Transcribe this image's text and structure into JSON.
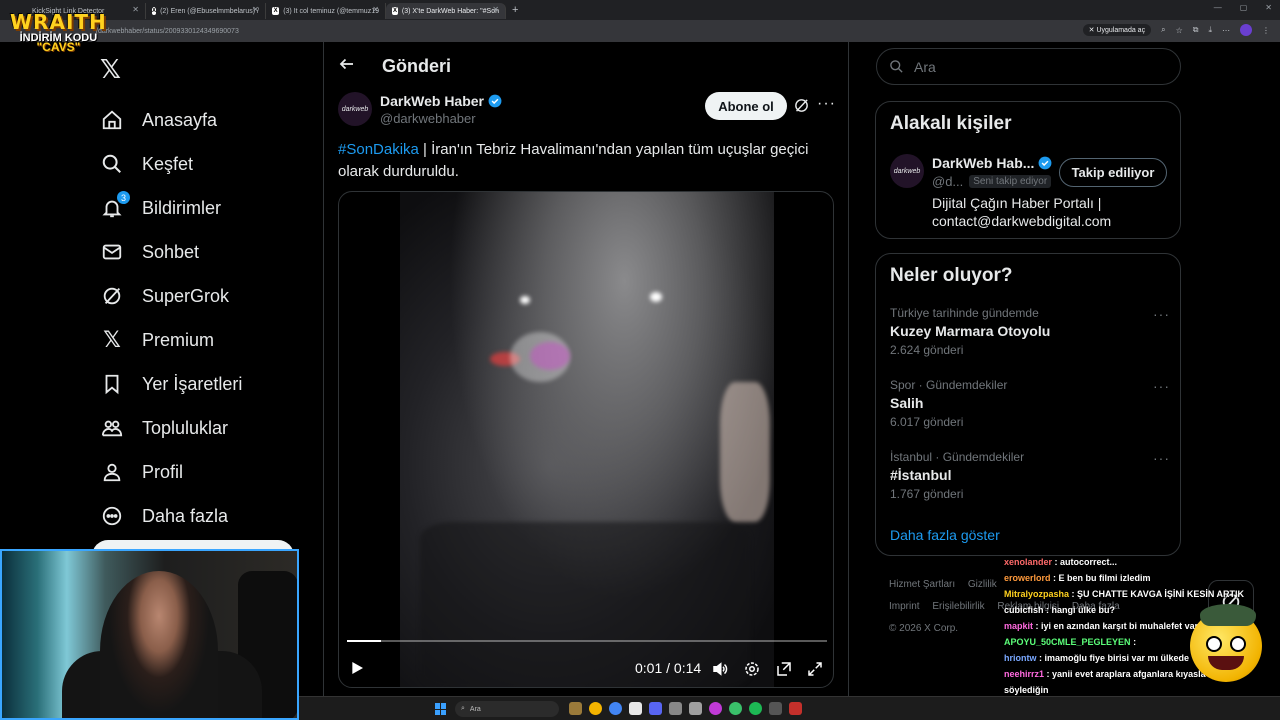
{
  "browser": {
    "tabs": [
      {
        "label": "KickSight Link Detector",
        "active": false
      },
      {
        "label": "(2) Eren (@Ebuselmmbelarus) /",
        "active": false
      },
      {
        "label": "(3) It col teminuz (@temmuz19",
        "active": false
      },
      {
        "label": "(3) X'te DarkWeb Haber: \"#Son",
        "active": true
      }
    ],
    "url": "/darkwebhaber/status/2009330124349690073",
    "open_in_app": "Uygulamada aç"
  },
  "overlay": {
    "brand": "WRAITH",
    "line2": "İNDİRİM KODU",
    "code": "\"CAVS\""
  },
  "nav": {
    "items": [
      {
        "label": "Anasayfa",
        "icon": "home-icon"
      },
      {
        "label": "Keşfet",
        "icon": "search-icon"
      },
      {
        "label": "Bildirimler",
        "icon": "bell-icon",
        "badge": "3"
      },
      {
        "label": "Sohbet",
        "icon": "mail-icon"
      },
      {
        "label": "SuperGrok",
        "icon": "grok-icon"
      },
      {
        "label": "Premium",
        "icon": "x-icon"
      },
      {
        "label": "Yer İşaretleri",
        "icon": "bookmark-icon"
      },
      {
        "label": "Topluluklar",
        "icon": "communities-icon"
      },
      {
        "label": "Profil",
        "icon": "profile-icon"
      },
      {
        "label": "Daha fazla",
        "icon": "more-circle-icon"
      }
    ]
  },
  "main": {
    "title": "Gönderi",
    "post": {
      "author": "DarkWeb Haber",
      "handle": "@darkwebhaber",
      "avatar_text": "darkweb",
      "subscribe_label": "Abone ol",
      "hashtag": "#SonDakika",
      "text": " | İran'ın Tebriz Havalimanı'ndan yapılan tüm uçuşlar geçici olarak durduruldu.",
      "video": {
        "current_time": "0:01",
        "separator": " / ",
        "duration": "0:14",
        "progress": 0.07
      }
    }
  },
  "right": {
    "search_placeholder": "Ara",
    "related": {
      "title": "Alakalı kişiler",
      "name": "DarkWeb Hab...",
      "handle": "@d...",
      "follows_you": "Seni takip ediyor",
      "follow_label": "Takip ediliyor",
      "bio": "Dijital Çağın Haber Portalı | contact@darkwebdigital.com"
    },
    "trends": {
      "title": "Neler oluyor?",
      "items": [
        {
          "meta": "Türkiye tarihinde gündemde",
          "name": "Kuzey Marmara Otoyolu",
          "count": "2.624 gönderi"
        },
        {
          "meta": "Spor · Gündemdekiler",
          "name": "Salih",
          "count": "6.017 gönderi"
        },
        {
          "meta": "İstanbul · Gündemdekiler",
          "name": "#İstanbul",
          "count": "1.767 gönderi"
        }
      ],
      "show_more": "Daha fazla göster"
    },
    "footer": {
      "links": [
        "Hizmet Şartları",
        "Gizlilik",
        "Imprint",
        "Erişilebilirlik",
        "Reklam bilgisi",
        "Daha fazla"
      ],
      "copyright": "© 2026 X Corp."
    }
  },
  "chat": [
    {
      "user": "xenolander",
      "color": "#ff6a6a",
      "msg": ": autocorrect..."
    },
    {
      "user": "erowerlord",
      "color": "#ff9a3c",
      "msg": ": E ben bu filmi izledim"
    },
    {
      "user": "Mitralyozpasha",
      "color": "#ffd21f",
      "msg": ": ŞU CHATTE KAVGA İŞİNİ KESİN ARTIK"
    },
    {
      "user": "cubicfish",
      "color": "#ffffff",
      "msg": ": hangi ülke bu?"
    },
    {
      "user": "mapkit",
      "color": "#ff6adf",
      "msg": ": iyi en azından karşıt bi muhalefet var"
    },
    {
      "user": "APOYU_50CMLE_PEGLEYEN",
      "color": "#5cff7a",
      "msg": ":"
    },
    {
      "user": "hriontw",
      "color": "#7aa8ff",
      "msg": ": imamoğlu fiye birisi var mı ülkede"
    },
    {
      "user": "neehirrz1",
      "color": "#ff6adf",
      "msg": ": yanii evet araplara afganlara kıyasla doğru söylediğin"
    }
  ],
  "taskbar": {
    "search_placeholder": "Ara"
  },
  "colors": {
    "accent": "#1d9bf0",
    "background": "#000000",
    "border": "#2f3336",
    "muted": "#71767b"
  }
}
